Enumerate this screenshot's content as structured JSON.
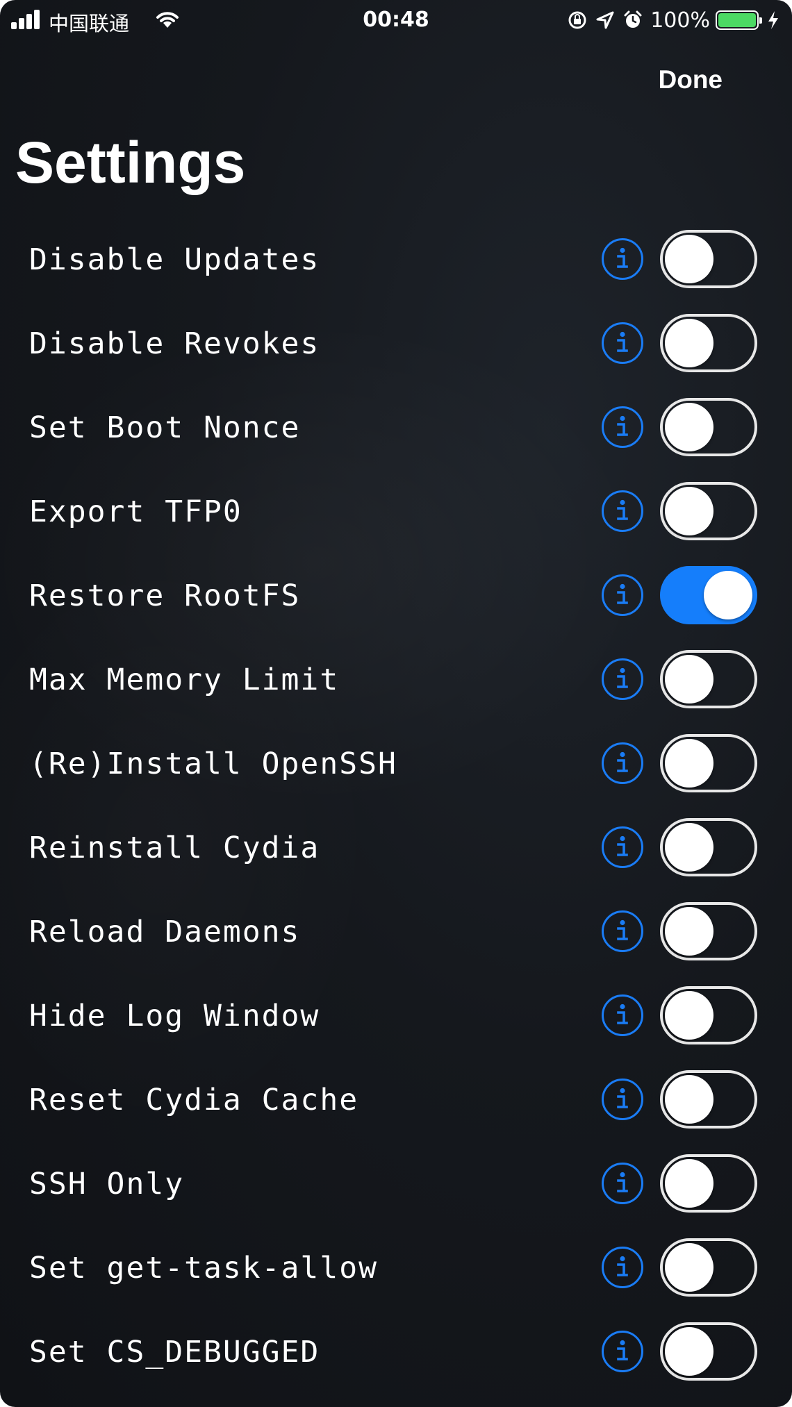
{
  "status_bar": {
    "carrier": "中国联通",
    "time": "00:48",
    "battery_percent": "100%",
    "battery_level": 1.0,
    "icons": [
      "signal-icon",
      "wifi-icon",
      "orientation-lock-icon",
      "location-icon",
      "alarm-icon",
      "battery-icon",
      "charging-bolt-icon"
    ]
  },
  "nav": {
    "done_label": "Done",
    "title": "Settings"
  },
  "colors": {
    "accent": "#157efb",
    "background": "#15181d",
    "text": "#ffffff"
  },
  "settings": [
    {
      "label": "Disable Updates",
      "enabled": false
    },
    {
      "label": "Disable Revokes",
      "enabled": false
    },
    {
      "label": "Set Boot Nonce",
      "enabled": false
    },
    {
      "label": "Export TFP0",
      "enabled": false
    },
    {
      "label": "Restore RootFS",
      "enabled": true
    },
    {
      "label": "Max Memory Limit",
      "enabled": false
    },
    {
      "label": "(Re)Install OpenSSH",
      "enabled": false
    },
    {
      "label": "Reinstall Cydia",
      "enabled": false
    },
    {
      "label": "Reload Daemons",
      "enabled": false
    },
    {
      "label": "Hide Log Window",
      "enabled": false
    },
    {
      "label": "Reset Cydia Cache",
      "enabled": false
    },
    {
      "label": "SSH Only",
      "enabled": false
    },
    {
      "label": "Set get-task-allow",
      "enabled": false
    },
    {
      "label": "Set CS_DEBUGGED",
      "enabled": false
    }
  ]
}
